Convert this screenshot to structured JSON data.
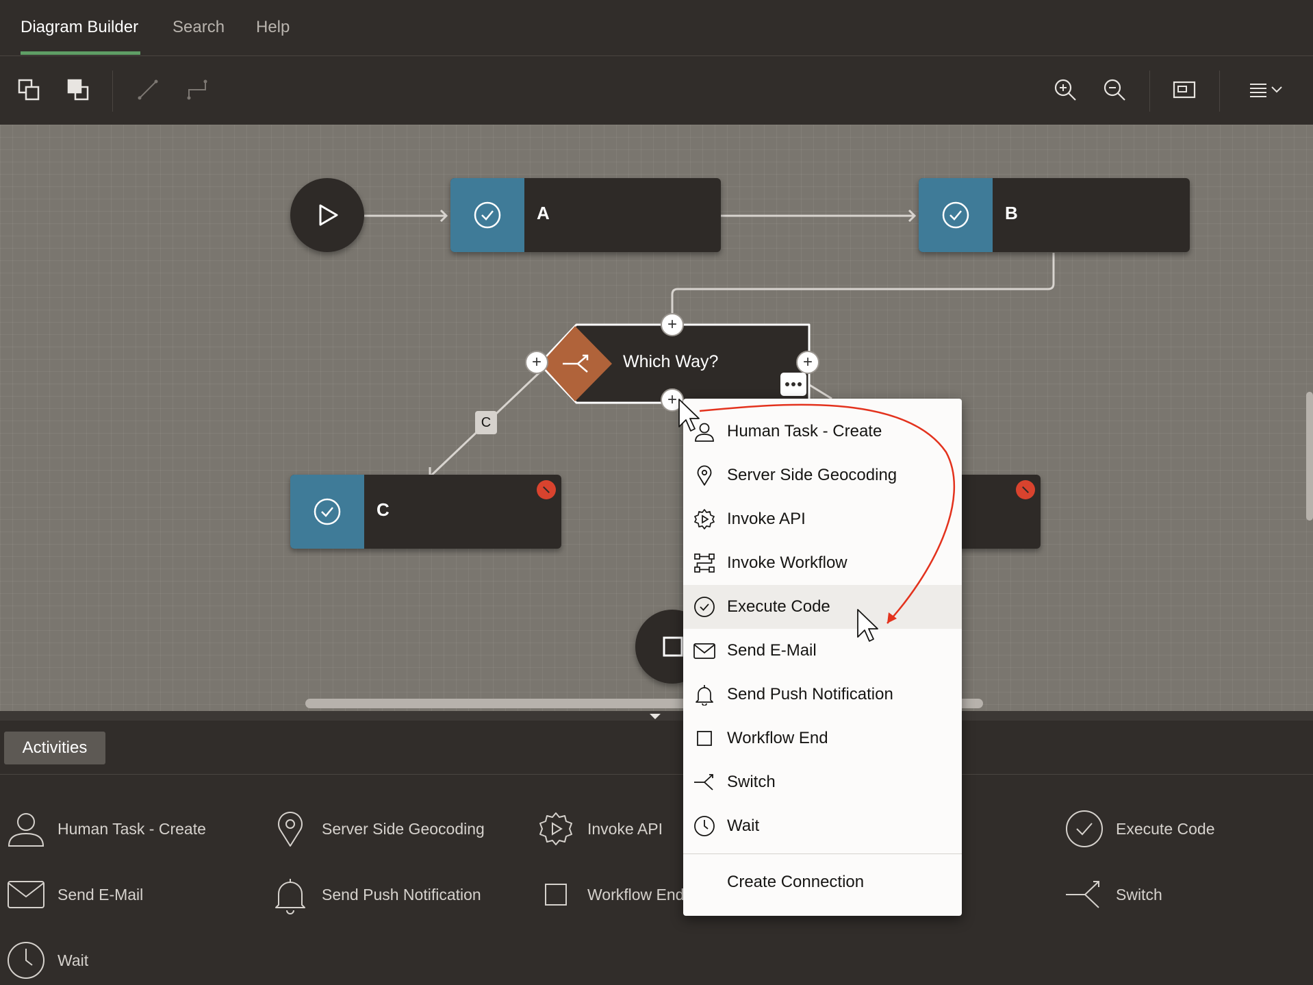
{
  "tabs": [
    {
      "label": "Diagram Builder",
      "active": true
    },
    {
      "label": "Search",
      "active": false
    },
    {
      "label": "Help",
      "active": false
    }
  ],
  "toolbar": {
    "buttons": [
      "bring-to-front-icon",
      "send-to-back-icon",
      "straight-connector-icon",
      "elbow-connector-icon",
      "zoom-in-icon",
      "zoom-out-icon",
      "fit-view-icon",
      "menu-icon"
    ]
  },
  "diagram": {
    "nodes": {
      "a": {
        "label": "A"
      },
      "b": {
        "label": "B"
      },
      "c": {
        "label": "C"
      },
      "switch": {
        "label": "Which Way?"
      }
    },
    "connections": {
      "c_label": "C"
    }
  },
  "context_menu": {
    "items": [
      {
        "label": "Human Task - Create",
        "icon": "person-icon"
      },
      {
        "label": "Server Side Geocoding",
        "icon": "location-pin-icon"
      },
      {
        "label": "Invoke API",
        "icon": "api-gear-icon"
      },
      {
        "label": "Invoke Workflow",
        "icon": "workflow-icon"
      },
      {
        "label": "Execute Code",
        "icon": "check-circle-icon",
        "highlighted": true
      },
      {
        "label": "Send E-Mail",
        "icon": "envelope-icon"
      },
      {
        "label": "Send Push Notification",
        "icon": "bell-icon"
      },
      {
        "label": "Workflow End",
        "icon": "square-icon"
      },
      {
        "label": "Switch",
        "icon": "switch-icon"
      },
      {
        "label": "Wait",
        "icon": "clock-icon"
      }
    ],
    "footer_item": {
      "label": "Create Connection"
    }
  },
  "activities_panel": {
    "tab_label": "Activities",
    "items": [
      {
        "label": "Human Task - Create",
        "icon": "person-icon"
      },
      {
        "label": "Server Side Geocoding",
        "icon": "location-pin-icon"
      },
      {
        "label": "Invoke API",
        "icon": "api-gear-icon"
      },
      {
        "label": "Execute Code",
        "icon": "check-circle-icon"
      },
      {
        "label": "Send E-Mail",
        "icon": "envelope-icon"
      },
      {
        "label": "Send Push Notification",
        "icon": "bell-icon"
      },
      {
        "label": "Workflow End",
        "icon": "square-icon"
      },
      {
        "label": "Switch",
        "icon": "switch-icon"
      },
      {
        "label": "Wait",
        "icon": "clock-icon"
      }
    ]
  },
  "colors": {
    "activity_strip": "#3f7b98",
    "switch_diamond": "#b0633a",
    "error_badge": "#d9432e",
    "annotation_arrow": "#e3321d",
    "active_tab_underline": "#5f9e65"
  }
}
